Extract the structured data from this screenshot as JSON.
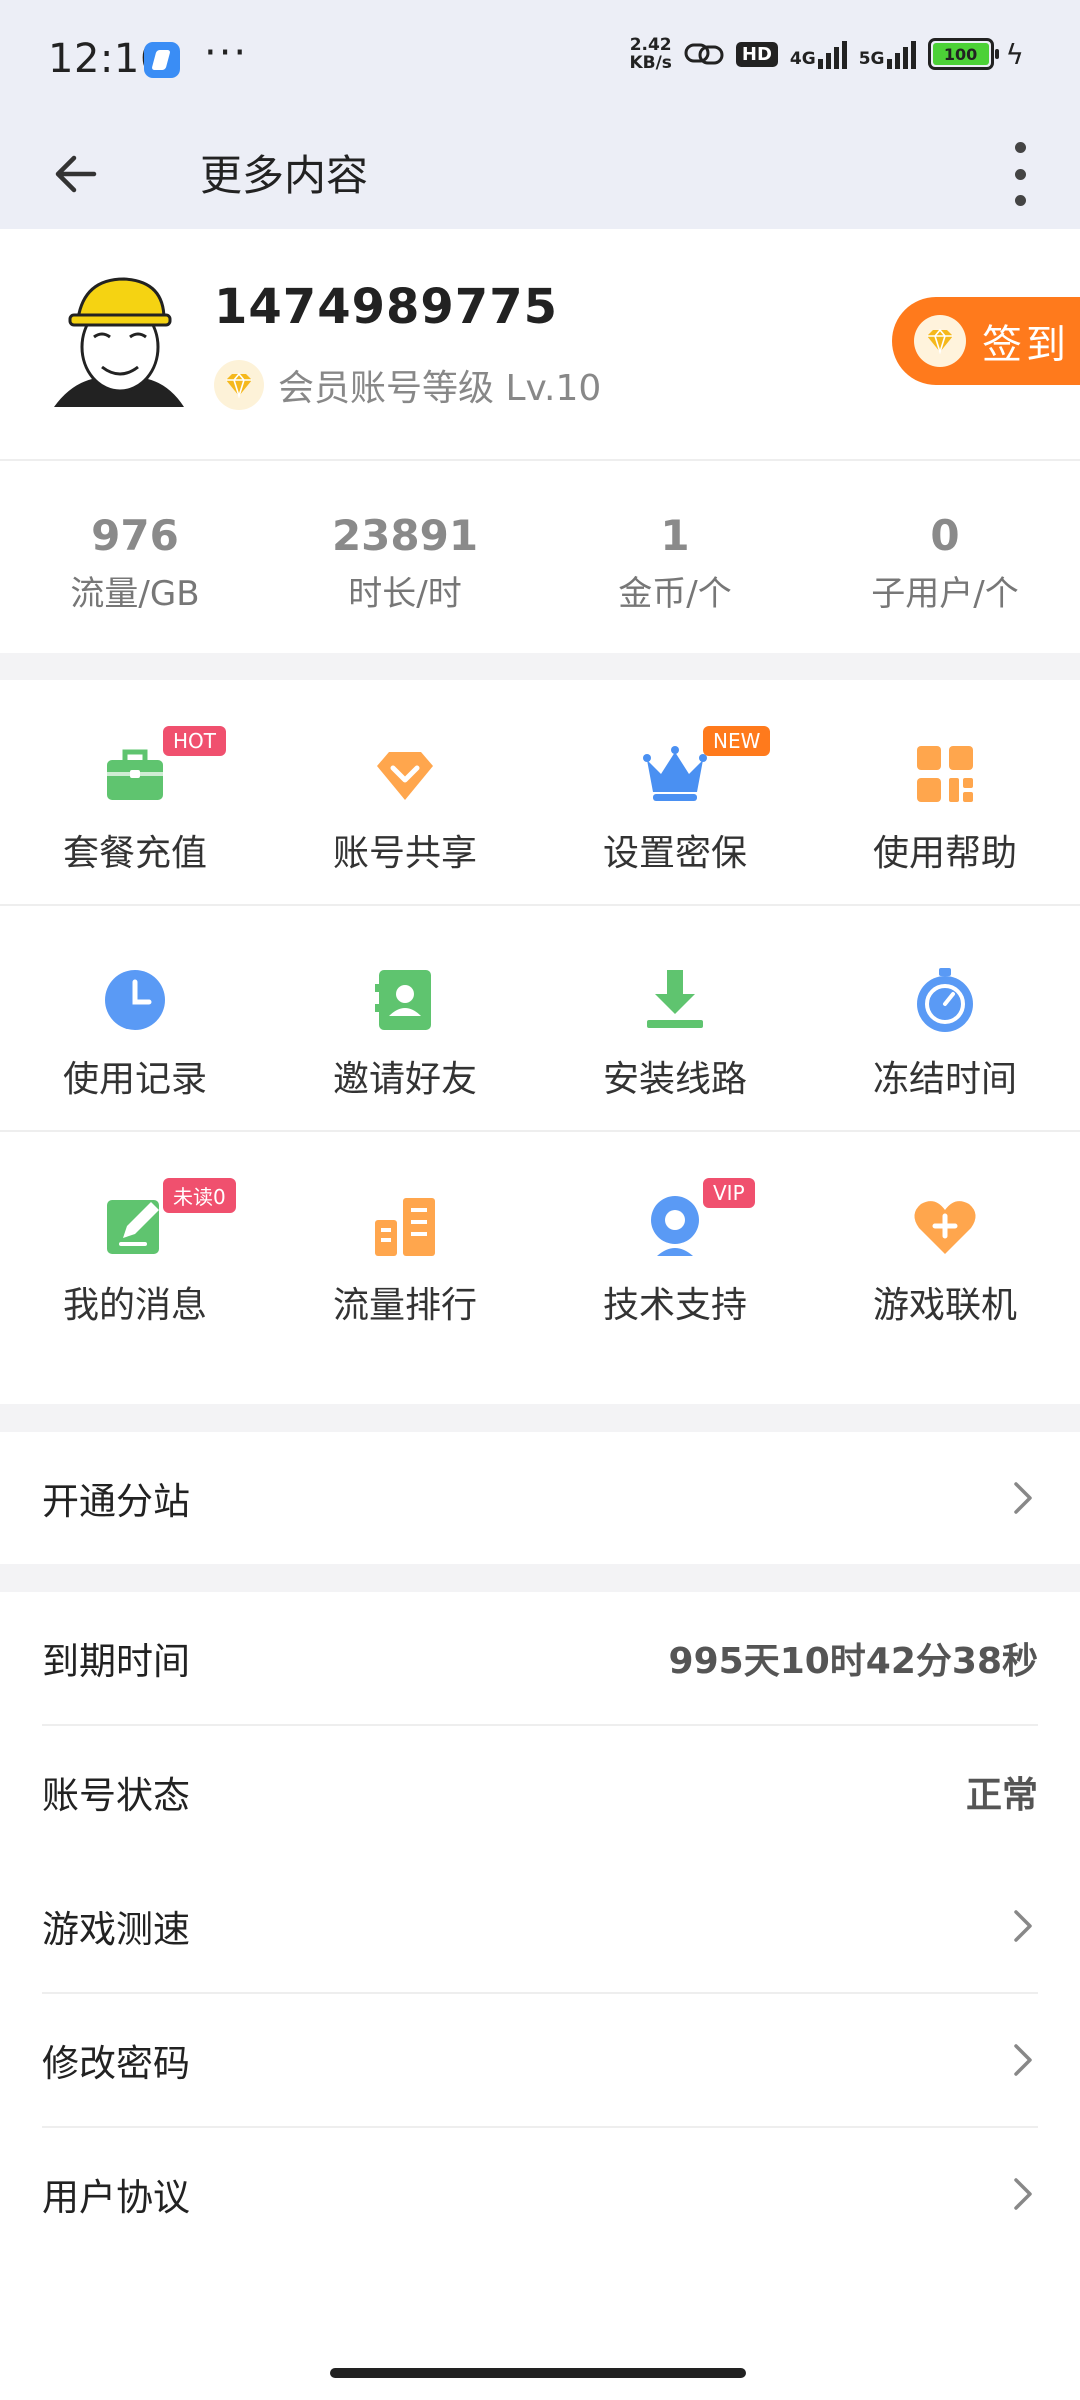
{
  "status_bar": {
    "time": "12:16",
    "more": "···",
    "net_speed_value": "2.42",
    "net_speed_unit": "KB/s",
    "hd": "HD",
    "sig1": "4G",
    "sig2": "5G",
    "battery": "100"
  },
  "appbar": {
    "title": "更多内容"
  },
  "profile": {
    "user_id": "1474989775",
    "level_text": "会员账号等级 Lv.10",
    "signin_label": "签到"
  },
  "stats": [
    {
      "value": "976",
      "label": "流量/GB"
    },
    {
      "value": "23891",
      "label": "时长/时"
    },
    {
      "value": "1",
      "label": "金币/个"
    },
    {
      "value": "0",
      "label": "子用户/个"
    }
  ],
  "grid": [
    {
      "label": "套餐充值",
      "icon": "briefcase-icon",
      "color": "#5fc46f",
      "badge": "HOT"
    },
    {
      "label": "账号共享",
      "icon": "diamond-icon",
      "color": "#ffa64d"
    },
    {
      "label": "设置密保",
      "icon": "crown-icon",
      "color": "#4a90f2",
      "badge": "NEW"
    },
    {
      "label": "使用帮助",
      "icon": "grid-icon",
      "color": "#ffa64d"
    },
    {
      "label": "使用记录",
      "icon": "clock-icon",
      "color": "#5a9af5"
    },
    {
      "label": "邀请好友",
      "icon": "contact-icon",
      "color": "#5fc46f"
    },
    {
      "label": "安装线路",
      "icon": "download-icon",
      "color": "#5fc46f"
    },
    {
      "label": "冻结时间",
      "icon": "stopwatch-icon",
      "color": "#5a9af5"
    },
    {
      "label": "我的消息",
      "icon": "edit-icon",
      "color": "#5fc46f",
      "badge": "未读0"
    },
    {
      "label": "流量排行",
      "icon": "building-icon",
      "color": "#ffa64d"
    },
    {
      "label": "技术支持",
      "icon": "webcam-icon",
      "color": "#5a9af5",
      "badge": "VIP"
    },
    {
      "label": "游戏联机",
      "icon": "heart-plus-icon",
      "color": "#ffa64d"
    }
  ],
  "list": {
    "open_substation": "开通分站",
    "expire_label": "到期时间",
    "expire_value": "995天10时42分38秒",
    "status_label": "账号状态",
    "status_value": "正常",
    "speed_test": "游戏测速",
    "change_password": "修改密码",
    "user_agreement": "用户协议"
  }
}
